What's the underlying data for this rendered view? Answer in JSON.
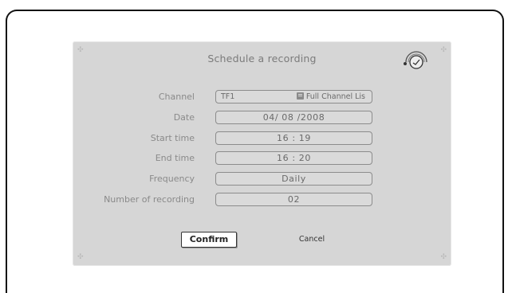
{
  "dialog": {
    "title": "Schedule a recording"
  },
  "form": {
    "channel": {
      "label": "Channel",
      "value": "TF1",
      "list_label": "Full Channel Lis"
    },
    "date": {
      "label": "Date",
      "value": "04/ 08 /2008"
    },
    "start_time": {
      "label": "Start time",
      "value": "16 : 19"
    },
    "end_time": {
      "label": "End time",
      "value": "16 : 20"
    },
    "frequency": {
      "label": "Frequency",
      "value": "Daily"
    },
    "number_of_recording": {
      "label": "Number of recording",
      "value": "02"
    }
  },
  "buttons": {
    "confirm": "Confirm",
    "cancel": "Cancel"
  },
  "icons": {
    "title_icon": "clock-timer-icon",
    "list_icon": "channel-list-icon"
  },
  "colors": {
    "dialog_bg": "#d6d6d6",
    "text_muted": "#8a8a8a",
    "field_border": "#8c8c8c"
  }
}
